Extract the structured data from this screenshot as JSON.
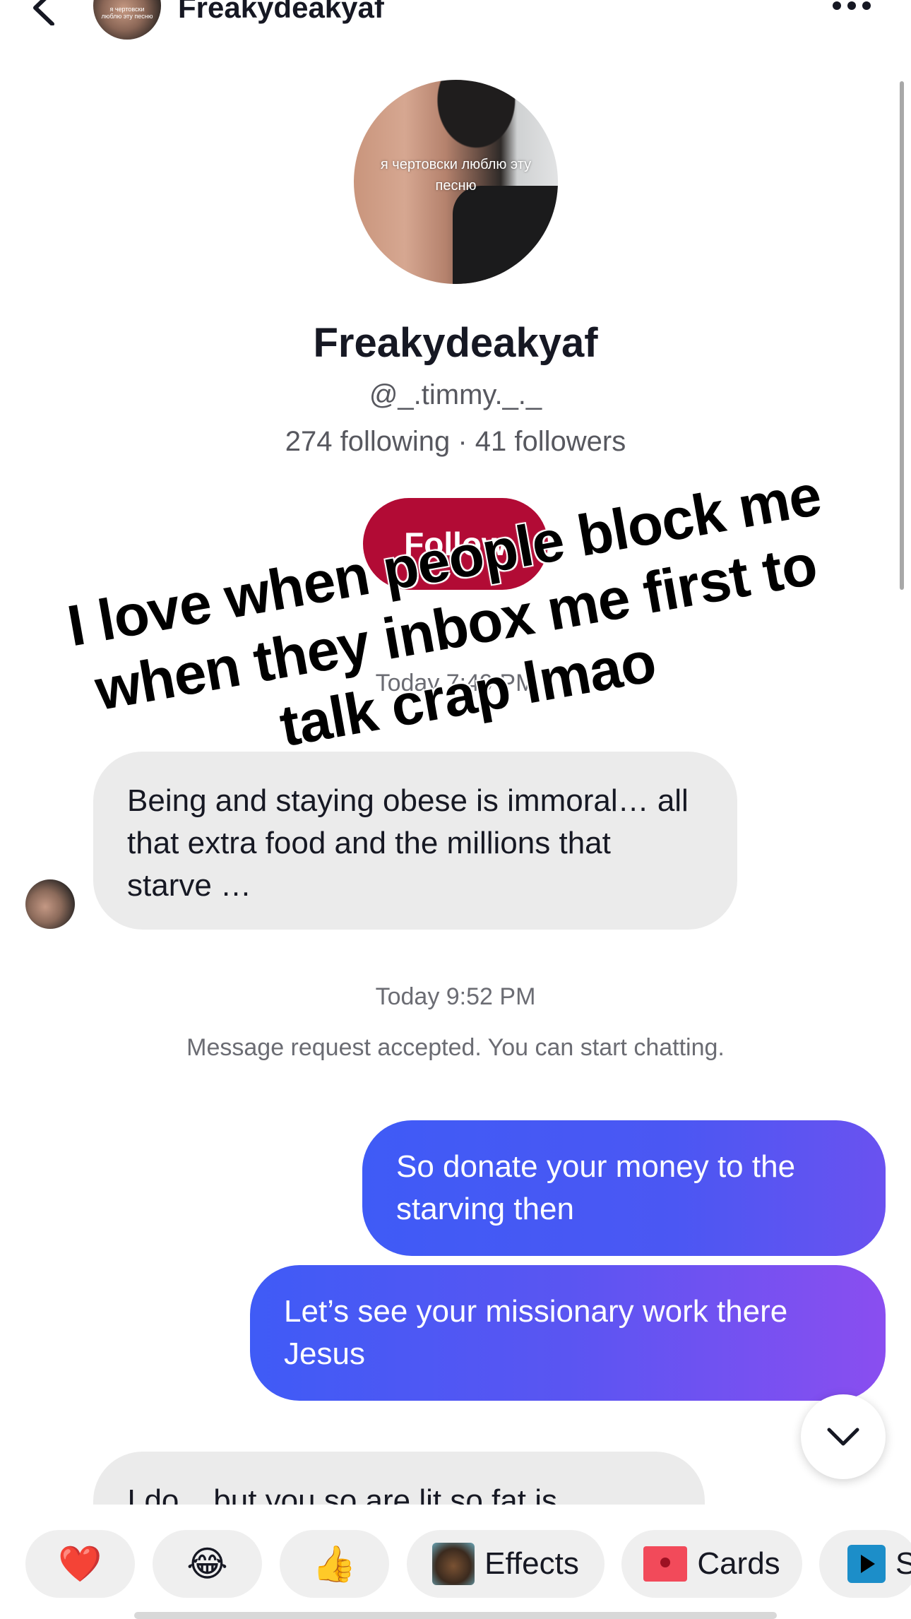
{
  "header": {
    "title": "Freakydeakyaf",
    "avatar_caption": "я чертовски люблю эту песню"
  },
  "profile": {
    "avatar_caption": "я чертовски люблю эту песню",
    "name": "Freakydeakyaf",
    "handle": "@_.timmy._._",
    "stats": "274 following · 41 followers",
    "follow_label": "Follow"
  },
  "overlay_caption": "I love when people block me when they inbox me first to talk crap lmao",
  "messages": {
    "timestamp_1": "Today 7:49 PM",
    "incoming_1": "Being and staying obese is immoral… all that extra food and the millions that starve …",
    "timestamp_2": "Today 9:52 PM",
    "system_notice": "Message request accepted. You can start chatting.",
    "outgoing_1": "So donate your money to the starving then",
    "outgoing_2": "Let’s see your missionary work there Jesus",
    "incoming_partial": "I do... but you so are lit so fat is"
  },
  "quick_actions": {
    "heart": "❤️",
    "laugh": "😂",
    "thumbs": "👍",
    "effects_label": "Effects",
    "cards_label": "Cards",
    "partial_label": "S"
  },
  "colors": {
    "follow": "#b20b35",
    "outgoing_start": "#3f5bf6",
    "outgoing_end": "#8a4ef0",
    "incoming_bg": "#ebebeb"
  }
}
